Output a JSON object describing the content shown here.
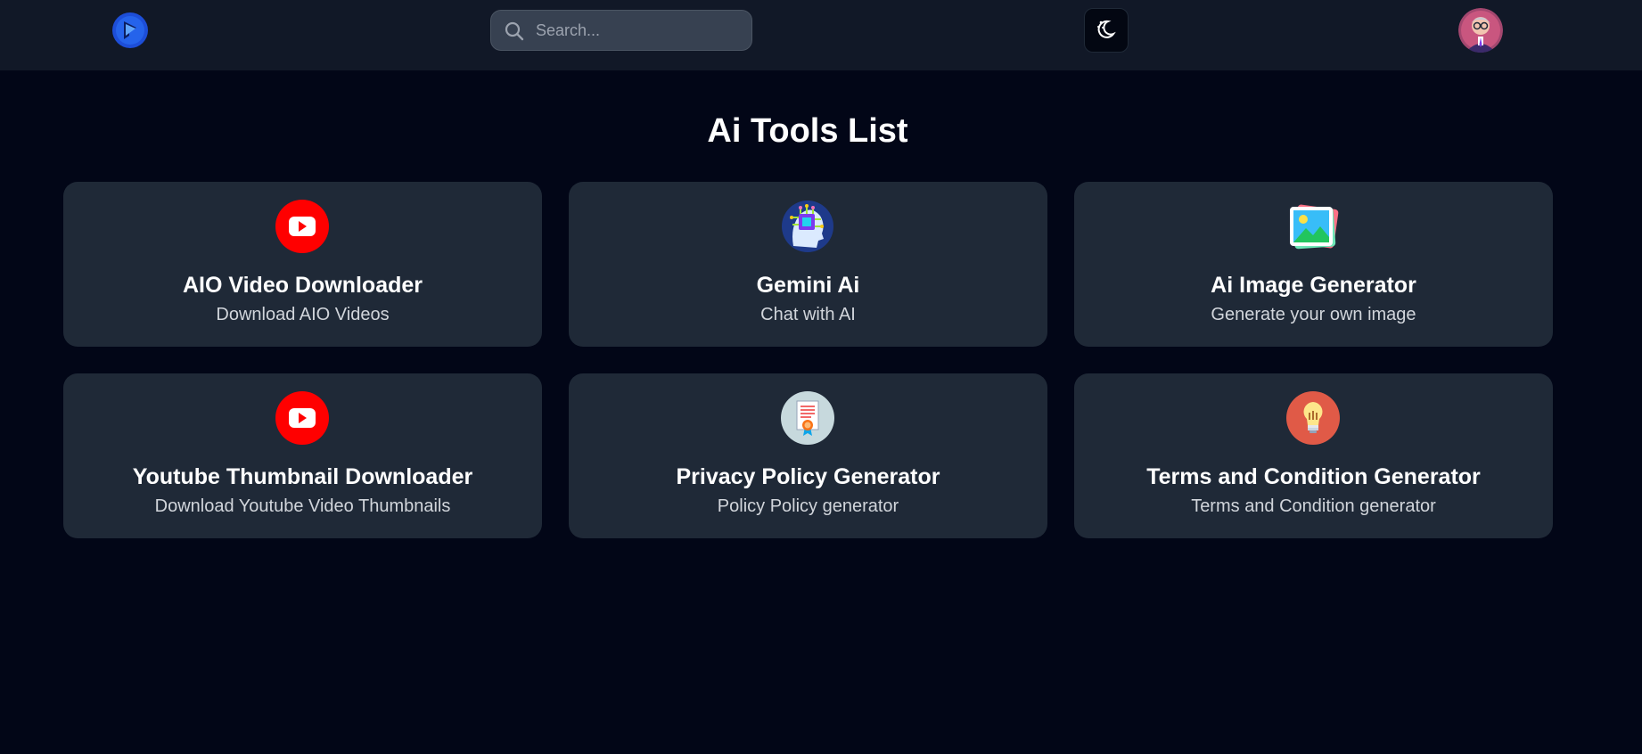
{
  "header": {
    "logo": "logo-icon",
    "search": {
      "placeholder": "Search...",
      "value": "",
      "icon": "search-icon"
    },
    "theme_toggle": {
      "icon": "moon-stars-icon"
    },
    "avatar": "user-avatar"
  },
  "main": {
    "title": "Ai Tools List",
    "tools": [
      {
        "title": "AIO Video Downloader",
        "description": "Download AIO Videos",
        "icon": "youtube-icon"
      },
      {
        "title": "Gemini Ai",
        "description": "Chat with AI",
        "icon": "ai-brain-chip-icon"
      },
      {
        "title": "Ai Image Generator",
        "description": "Generate your own image",
        "icon": "image-gallery-icon"
      },
      {
        "title": "Youtube Thumbnail Downloader",
        "description": "Download Youtube Video Thumbnails",
        "icon": "youtube-icon"
      },
      {
        "title": "Privacy Policy Generator",
        "description": "Policy Policy generator",
        "icon": "certificate-document-icon"
      },
      {
        "title": "Terms and Condition Generator",
        "description": "Terms and Condition generator",
        "icon": "lightbulb-icon"
      }
    ]
  },
  "colors": {
    "background": "#020617",
    "header": "#111827",
    "card": "#1f2937",
    "search_field": "#374151",
    "youtube_red": "#ff0000",
    "accent_blue": "#2563eb"
  }
}
